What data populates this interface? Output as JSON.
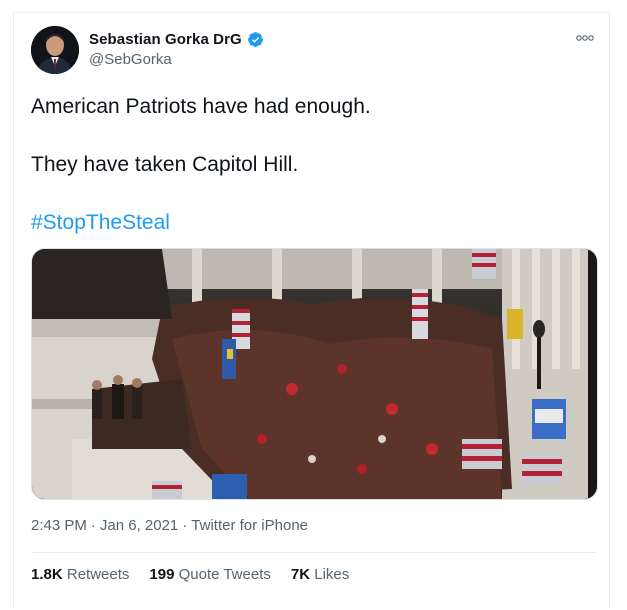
{
  "author": {
    "display_name": "Sebastian Gorka DrG",
    "handle": "@SebGorka",
    "verified": true,
    "verified_color": "#1d9bf0"
  },
  "tweet": {
    "line1": "American Patriots have had enough.",
    "line2": "They have taken Capitol Hill.",
    "hashtag": "#StopTheSteal",
    "hashtag_color": "#1d9bf0"
  },
  "meta": {
    "time": "2:43 PM",
    "separator1": "·",
    "date": "Jan 6, 2021",
    "separator2": "·",
    "source": "Twitter for iPhone"
  },
  "stats": {
    "retweets_count": "1.8K",
    "retweets_label": "Retweets",
    "quotes_count": "199",
    "quotes_label": "Quote Tweets",
    "likes_count": "7K",
    "likes_label": "Likes"
  },
  "icons": {
    "more": "more-options-icon",
    "verified": "verified-badge-icon"
  }
}
